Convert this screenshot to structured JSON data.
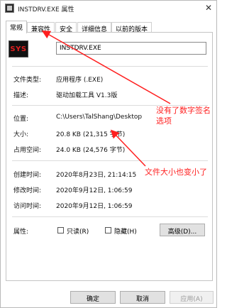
{
  "window": {
    "title": "INSTDRV.EXE 属性",
    "close_glyph": "✕"
  },
  "tabs": [
    {
      "label": "常规",
      "active": true
    },
    {
      "label": "兼容性",
      "active": false
    },
    {
      "label": "安全",
      "active": false
    },
    {
      "label": "详细信息",
      "active": false
    },
    {
      "label": "以前的版本",
      "active": false
    }
  ],
  "file": {
    "icon_text": "SYS",
    "name": "INSTDRV.EXE"
  },
  "properties": {
    "type_label": "文件类型:",
    "type_value": "应用程序 (.EXE)",
    "desc_label": "描述:",
    "desc_value": "驱动加载工具 V1.3版",
    "location_label": "位置:",
    "location_value": "C:\\Users\\TalShang\\Desktop",
    "size_label": "大小:",
    "size_value": "20.8 KB (21,315 字节)",
    "disk_label": "占用空间:",
    "disk_value": "24.0 KB (24,576 字节)",
    "created_label": "创建时间:",
    "created_value": "2020年8月23日, 21:14:15",
    "modified_label": "修改时间:",
    "modified_value": "2020年9月12日, 1:06:59",
    "accessed_label": "访问时间:",
    "accessed_value": "2020年9月12日, 1:06:59",
    "attributes_label": "属性:",
    "readonly_label": "只读(R)",
    "hidden_label": "隐藏(H)",
    "advanced_label": "高级(D)..."
  },
  "buttons": {
    "ok": "确定",
    "cancel": "取消",
    "apply": "应用(A)"
  },
  "annotations": {
    "signature_line1": "没有了数字签名",
    "signature_line2": "选项",
    "size_note": "文件大小也变小了",
    "color": "#ff1f1f"
  }
}
